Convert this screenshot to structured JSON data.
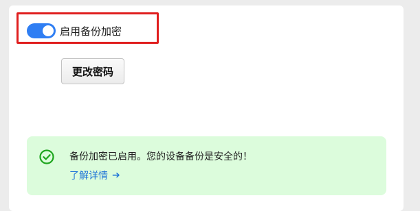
{
  "backup": {
    "encryption_toggle": {
      "label": "启用备份加密",
      "state": "on"
    },
    "change_password_label": "更改密码",
    "notice": {
      "message": "备份加密已启用。您的设备备份是安全的！",
      "link_label": "了解详情",
      "link_arrow": "➔"
    }
  },
  "colors": {
    "toggle_on": "#2f7ef3",
    "highlight": "#e01e1e",
    "success_bg": "#dcfcdc",
    "success_icon": "#1ea51e",
    "link": "#1f74d8"
  },
  "icons": {
    "status": "check-circle-icon",
    "link": "arrow-right-icon"
  }
}
